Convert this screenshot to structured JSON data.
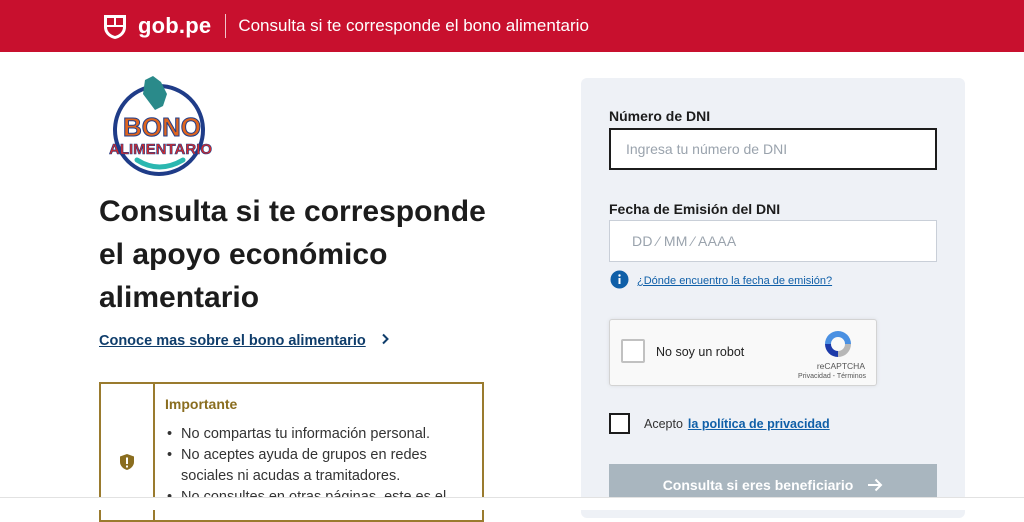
{
  "header": {
    "brand": "gob.pe",
    "title": "Consulta si te corresponde el bono alimentario"
  },
  "logo": {
    "line1": "BONO",
    "line2": "ALIMENTARIO"
  },
  "main": {
    "headline_lines": [
      "Consulta si te corresponde",
      "el apoyo económico",
      "alimentario"
    ],
    "more_link": "Conoce mas sobre el bono alimentario"
  },
  "notice": {
    "title": "Importante",
    "items": [
      "No compartas tu información personal.",
      "No aceptes ayuda de grupos en redes sociales ni acudas a tramitadores.",
      "No consultes en otras páginas, este es el"
    ]
  },
  "form": {
    "dni_label": "Número de DNI",
    "dni_placeholder": "Ingresa tu número de DNI",
    "date_label": "Fecha de Emisión del DNI",
    "date_placeholder": "DD ⁄ MM ⁄ AAAA",
    "help_link": "¿Dónde encuentro la fecha de emisión?",
    "captcha_text": "No soy un robot",
    "captcha_brand": "reCAPTCHA",
    "captcha_terms": "Privacidad - Términos",
    "accept_text": "Acepto",
    "privacy_link": "la política de privacidad",
    "submit": "Consulta si eres beneficiario"
  },
  "colors": {
    "header_bg": "#c8102e",
    "link": "#0f3d6b",
    "notice_border": "#9a7b2e",
    "submit_disabled": "#a9b6bf"
  }
}
